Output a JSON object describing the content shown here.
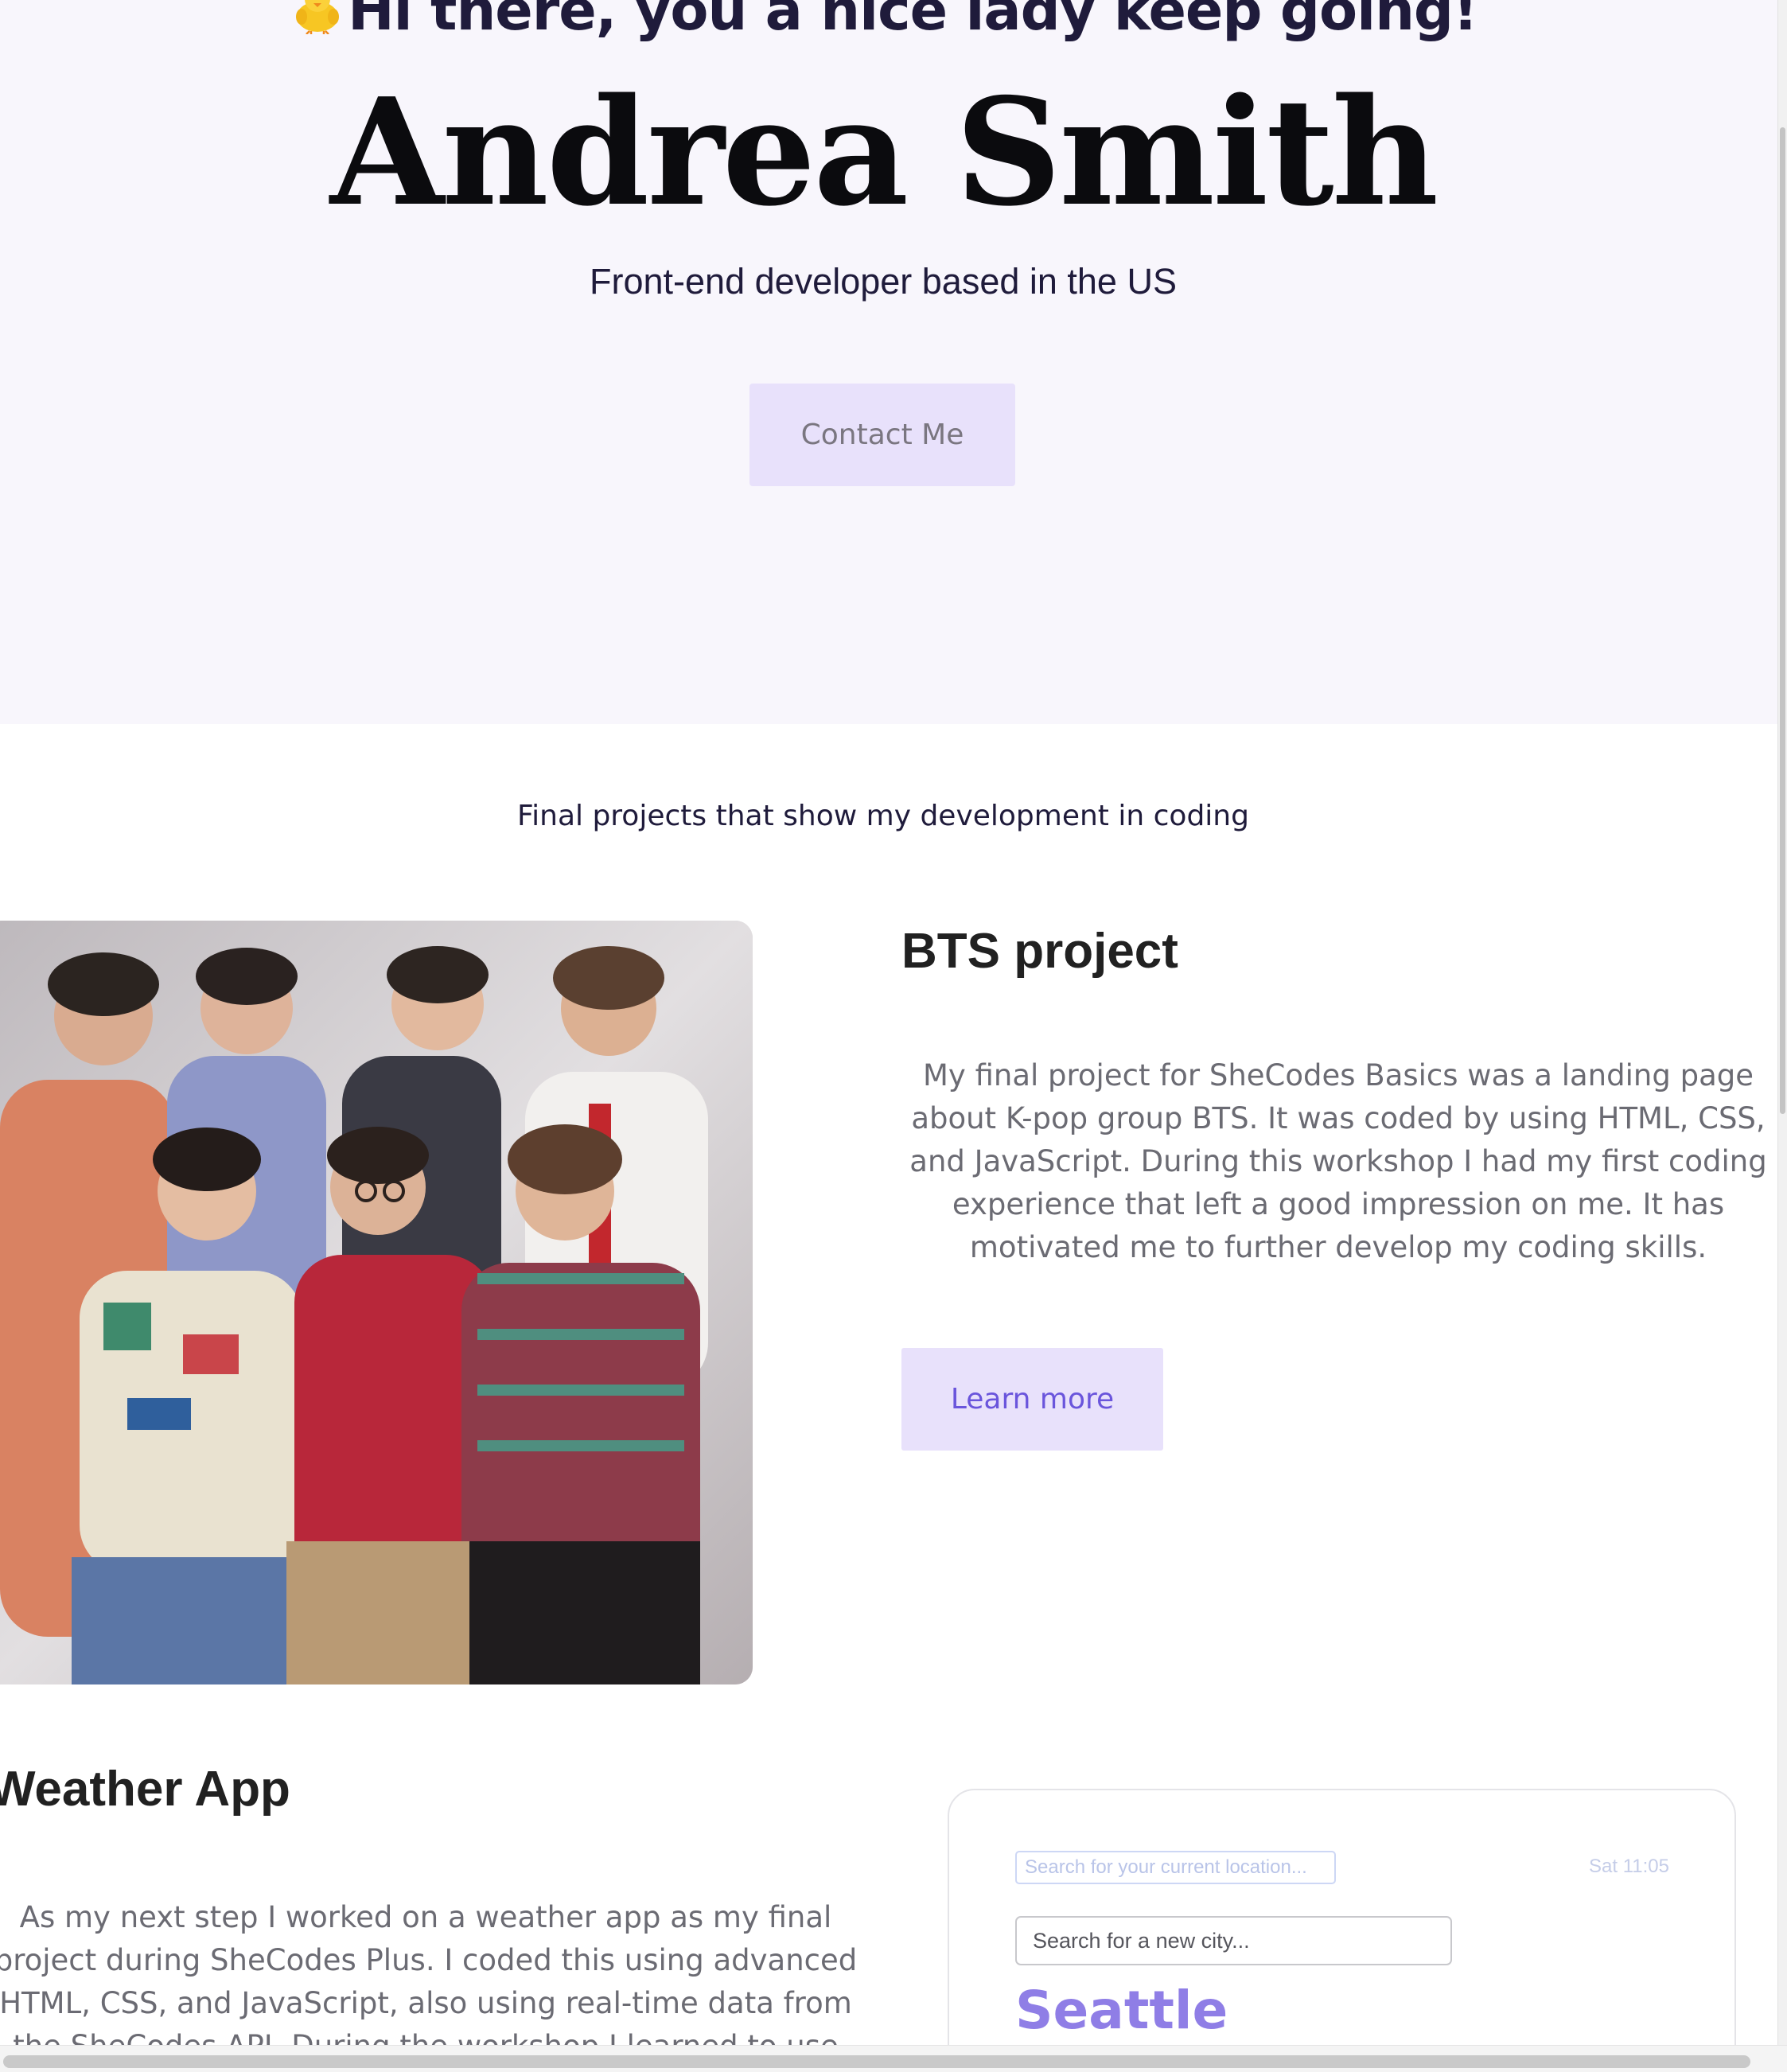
{
  "hero": {
    "greeting": "Hi there, you a nice lady keep going!",
    "greeting_icon": "chick-emoji-icon",
    "name": "Andrea Smith",
    "subtitle": "Front-end developer based in the US",
    "contact_label": "Contact Me"
  },
  "projects": {
    "intro": "Final projects that show my development in coding",
    "bts": {
      "title": "BTS project",
      "description": "My final project for SheCodes Basics was a landing page about K-pop group BTS. It was coded by using HTML, CSS, and JavaScript. During this workshop I had my first coding experience that left a good impression on me. It has motivated me to further develop my coding skills.",
      "learn_more_label": "Learn more",
      "image_icon": "group-photo-image"
    },
    "weather": {
      "title": "Weather App",
      "description": "As my next step I worked on a weather app as my final project during SheCodes Plus. I coded this using advanced HTML, CSS, and JavaScript, also using real-time data from the SheCodes API. During the workshop I learned to use",
      "preview": {
        "location_placeholder": "Search for your current location...",
        "date": "Sat 11:05",
        "city_placeholder": "Search for a new city...",
        "city": "Seattle"
      }
    }
  },
  "colors": {
    "hero_background": "#f8f6fc",
    "button_background": "#e8e1fb",
    "accent": "#6a55dc",
    "city_accent": "#8f7ee6",
    "text_dark": "#1f1b3b",
    "text_muted": "#6b6b73"
  }
}
